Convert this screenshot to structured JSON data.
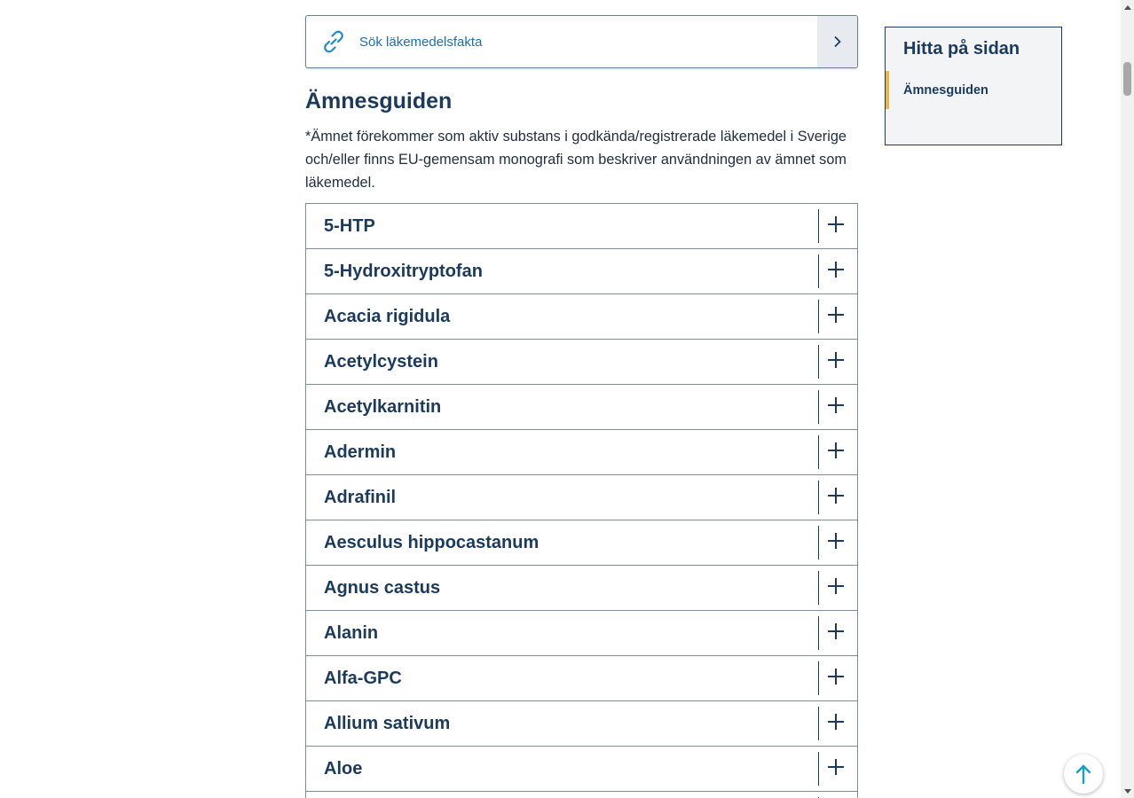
{
  "search_link": {
    "icon": "link-icon",
    "label": "Sök läkemedelsfakta",
    "arrow_icon": "chevron-right-icon"
  },
  "main": {
    "heading": "Ämnesguiden",
    "intro": "*Ämnet förekommer som aktiv substans i godkända/registrerade läkemedel i Sverige och/eller finns EU-gemensam monografi som beskriver användningen av ämnet som läkemedel."
  },
  "accordion": {
    "items": [
      {
        "title": "5-HTP"
      },
      {
        "title": "5-Hydroxitryptofan"
      },
      {
        "title": "Acacia rigidula"
      },
      {
        "title": "Acetylcystein"
      },
      {
        "title": "Acetylkarnitin"
      },
      {
        "title": "Adermin"
      },
      {
        "title": "Adrafinil"
      },
      {
        "title": "Aesculus hippocastanum"
      },
      {
        "title": "Agnus castus"
      },
      {
        "title": "Alanin"
      },
      {
        "title": "Alfa-GPC"
      },
      {
        "title": "Allium sativum"
      },
      {
        "title": "Aloe"
      },
      {
        "title": ""
      }
    ]
  },
  "toc": {
    "title": "Hitta på sidan",
    "items": [
      {
        "label": "Ämnesguiden",
        "active": true
      }
    ]
  },
  "colors": {
    "primary": "#1b3a5c",
    "link": "#1d6fb0",
    "accent_marker": "#e8b64a",
    "to_top_arrow": "#1a9bc6"
  },
  "to_top_icon": "arrow-up-icon"
}
